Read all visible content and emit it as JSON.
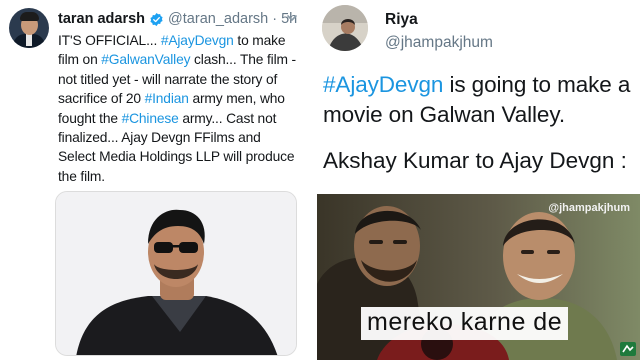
{
  "left_tweet": {
    "name": "taran adarsh",
    "handle": "@taran_adarsh",
    "separator": "·",
    "time": "5h",
    "text_segments": [
      {
        "t": "IT'S OFFICIAL... ",
        "tag": false
      },
      {
        "t": "#AjayDevgn",
        "tag": true
      },
      {
        "t": " to make film on ",
        "tag": false
      },
      {
        "t": "#GalwanValley",
        "tag": true
      },
      {
        "t": " clash... The film - not titled yet - will narrate the story of sacrifice of 20 ",
        "tag": false
      },
      {
        "t": "#Indian",
        "tag": true
      },
      {
        "t": " army men, who fought the ",
        "tag": false
      },
      {
        "t": "#Chinese",
        "tag": true
      },
      {
        "t": " army... Cast not finalized... Ajay Devgn FFilms and Select Media Holdings LLP will produce the film.",
        "tag": false
      }
    ],
    "icons": {
      "verified": "verified-badge-icon",
      "more": "chevron-down-icon"
    }
  },
  "right_tweet": {
    "name": "Riya",
    "handle": "@jhampakjhum",
    "hashtag": "#AjayDevgn",
    "text_rest": " is going to make a movie on Galwan Valley.",
    "line2": "Akshay Kumar to Ajay Devgn :",
    "meme_watermark": "@jhampakjhum",
    "meme_caption": "mereko karne de"
  },
  "colors": {
    "link": "#1b95e0",
    "text": "#14171a",
    "muted": "#657786",
    "verified": "#1da1f2"
  }
}
